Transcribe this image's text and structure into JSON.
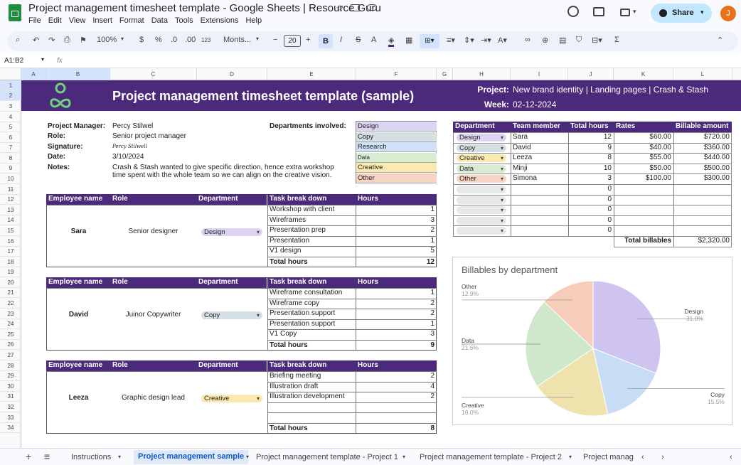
{
  "app": {
    "title": "Project management timesheet template - Google Sheets | Resource Guru",
    "share": "Share",
    "avatar": "J"
  },
  "menu": [
    "File",
    "Edit",
    "View",
    "Insert",
    "Format",
    "Data",
    "Tools",
    "Extensions",
    "Help"
  ],
  "toolbar": {
    "zoom": "100%",
    "currency": "$",
    "percent": "%",
    "dec_less": ".0",
    "dec_more": ".00",
    "num_fmt": "123",
    "font": "Monts...",
    "font_size": "20",
    "bold": "B",
    "italic": "I",
    "strike": "S",
    "textcolor": "A",
    "sigma": "Σ"
  },
  "formula_bar": {
    "cell_ref": "A1:B2",
    "fx": "fx"
  },
  "columns": [
    "A",
    "B",
    "C",
    "D",
    "E",
    "F",
    "G",
    "H",
    "I",
    "J",
    "K",
    "L"
  ],
  "rows": [
    "1",
    "2",
    "3",
    "4",
    "5",
    "6",
    "7",
    "8",
    "9",
    "10",
    "11",
    "12",
    "13",
    "14",
    "15",
    "16",
    "17",
    "18",
    "19",
    "20",
    "21",
    "22",
    "23",
    "24",
    "25",
    "26",
    "27",
    "28",
    "29",
    "30",
    "31",
    "32",
    "33",
    "34"
  ],
  "banner": {
    "title": "Project management timesheet template (sample)",
    "project_label": "Project:",
    "project_value": "New brand identity | Landing pages | Crash & Stash",
    "week_label": "Week:",
    "week_value": "02-12-2024"
  },
  "info": {
    "pm_label": "Project Manager:",
    "pm": "Percy Stilwel",
    "role_label": "Role:",
    "role": "Senior project manager",
    "sig_label": "Signature:",
    "sig": "Percy Stilwell",
    "date_label": "Date:",
    "date": "3/10/2024",
    "notes_label": "Notes:",
    "notes1": "Crash & Stash wanted to give specific direction, hence extra workshop",
    "notes2": "time spent with the whole team so we can align on the creative vision.",
    "dept_label": "Departments involved:"
  },
  "departments": [
    {
      "name": "Design",
      "color": "#ddd4f2"
    },
    {
      "name": "Copy",
      "color": "#d3dfe3"
    },
    {
      "name": "Research",
      "color": "#cde2f6"
    },
    {
      "name": "Data",
      "color": "#d8ecd2"
    },
    {
      "name": "Creative",
      "color": "#fbe9b2"
    },
    {
      "name": "Other",
      "color": "#f6d3c2"
    }
  ],
  "table_headers": {
    "employee": "Employee name",
    "role": "Role",
    "department": "Department",
    "task": "Task break down",
    "hours": "Hours",
    "total": "Total hours"
  },
  "employees": [
    {
      "name": "Sara",
      "role": "Senior designer",
      "dept": "Design",
      "color": "#ddd4f2",
      "tasks": [
        [
          "Workshop with client",
          "1"
        ],
        [
          "Wireframes",
          "3"
        ],
        [
          "Presentation prep",
          "2"
        ],
        [
          "Presentation",
          "1"
        ],
        [
          "V1 design",
          "5"
        ]
      ],
      "total": "12"
    },
    {
      "name": "David",
      "role": "Juinor Copywriter",
      "dept": "Copy",
      "color": "#d3dfe3",
      "tasks": [
        [
          "Wireframe consultation",
          "1"
        ],
        [
          "Wireframe copy",
          "2"
        ],
        [
          "Presentation support",
          "2"
        ],
        [
          "Presentation support",
          "1"
        ],
        [
          "V1 Copy",
          "3"
        ]
      ],
      "total": "9"
    },
    {
      "name": "Leeza",
      "role": "Graphic design lead",
      "dept": "Creative",
      "color": "#fbe9b2",
      "tasks": [
        [
          "Briefing meeting",
          "2"
        ],
        [
          "Illustration draft",
          "4"
        ],
        [
          "Illustration development",
          "2"
        ],
        [
          "",
          ""
        ],
        [
          "",
          ""
        ]
      ],
      "total": "8"
    }
  ],
  "billing": {
    "headers": [
      "Department",
      "Team member",
      "Total hours",
      "Rates",
      "Billable amount"
    ],
    "rows": [
      {
        "dept": "Design",
        "color": "#ddd4f2",
        "member": "Sara",
        "hours": "12",
        "rate": "$60.00",
        "amount": "$720.00"
      },
      {
        "dept": "Copy",
        "color": "#d3dfe3",
        "member": "David",
        "hours": "9",
        "rate": "$40.00",
        "amount": "$360.00"
      },
      {
        "dept": "Creative",
        "color": "#fbe9b2",
        "member": "Leeza",
        "hours": "8",
        "rate": "$55.00",
        "amount": "$440.00"
      },
      {
        "dept": "Data",
        "color": "#d8ecd2",
        "member": "Minji",
        "hours": "10",
        "rate": "$50.00",
        "amount": "$500.00"
      },
      {
        "dept": "Other",
        "color": "#f6d3c2",
        "member": "Simona",
        "hours": "3",
        "rate": "$100.00",
        "amount": "$300.00"
      },
      {
        "dept": "",
        "color": "#e8e8e8",
        "member": "",
        "hours": "0",
        "rate": "",
        "amount": ""
      },
      {
        "dept": "",
        "color": "#e8e8e8",
        "member": "",
        "hours": "0",
        "rate": "",
        "amount": ""
      },
      {
        "dept": "",
        "color": "#e8e8e8",
        "member": "",
        "hours": "0",
        "rate": "",
        "amount": ""
      },
      {
        "dept": "",
        "color": "#e8e8e8",
        "member": "",
        "hours": "0",
        "rate": "",
        "amount": ""
      },
      {
        "dept": "",
        "color": "#e8e8e8",
        "member": "",
        "hours": "0",
        "rate": "",
        "amount": ""
      }
    ],
    "total_label": "Total billables",
    "total": "$2,320.00"
  },
  "chart_data": {
    "type": "pie",
    "title": "Billables by department",
    "slices": [
      {
        "label": "Design",
        "pct": "31.0%",
        "value": 31.0,
        "color": "#cfc4f0"
      },
      {
        "label": "Copy",
        "pct": "15.5%",
        "value": 15.5,
        "color": "#c7ddf6"
      },
      {
        "label": "Creative",
        "pct": "19.0%",
        "value": 19.0,
        "color": "#f0e2ad"
      },
      {
        "label": "Data",
        "pct": "21.6%",
        "value": 21.6,
        "color": "#cfe8cc"
      },
      {
        "label": "Other",
        "pct": "12.9%",
        "value": 12.9,
        "color": "#f6cdb8"
      }
    ]
  },
  "tabs": [
    "Instructions",
    "Project management sample",
    "Project management template - Project 1",
    "Project management template - Project 2",
    "Project manag"
  ]
}
